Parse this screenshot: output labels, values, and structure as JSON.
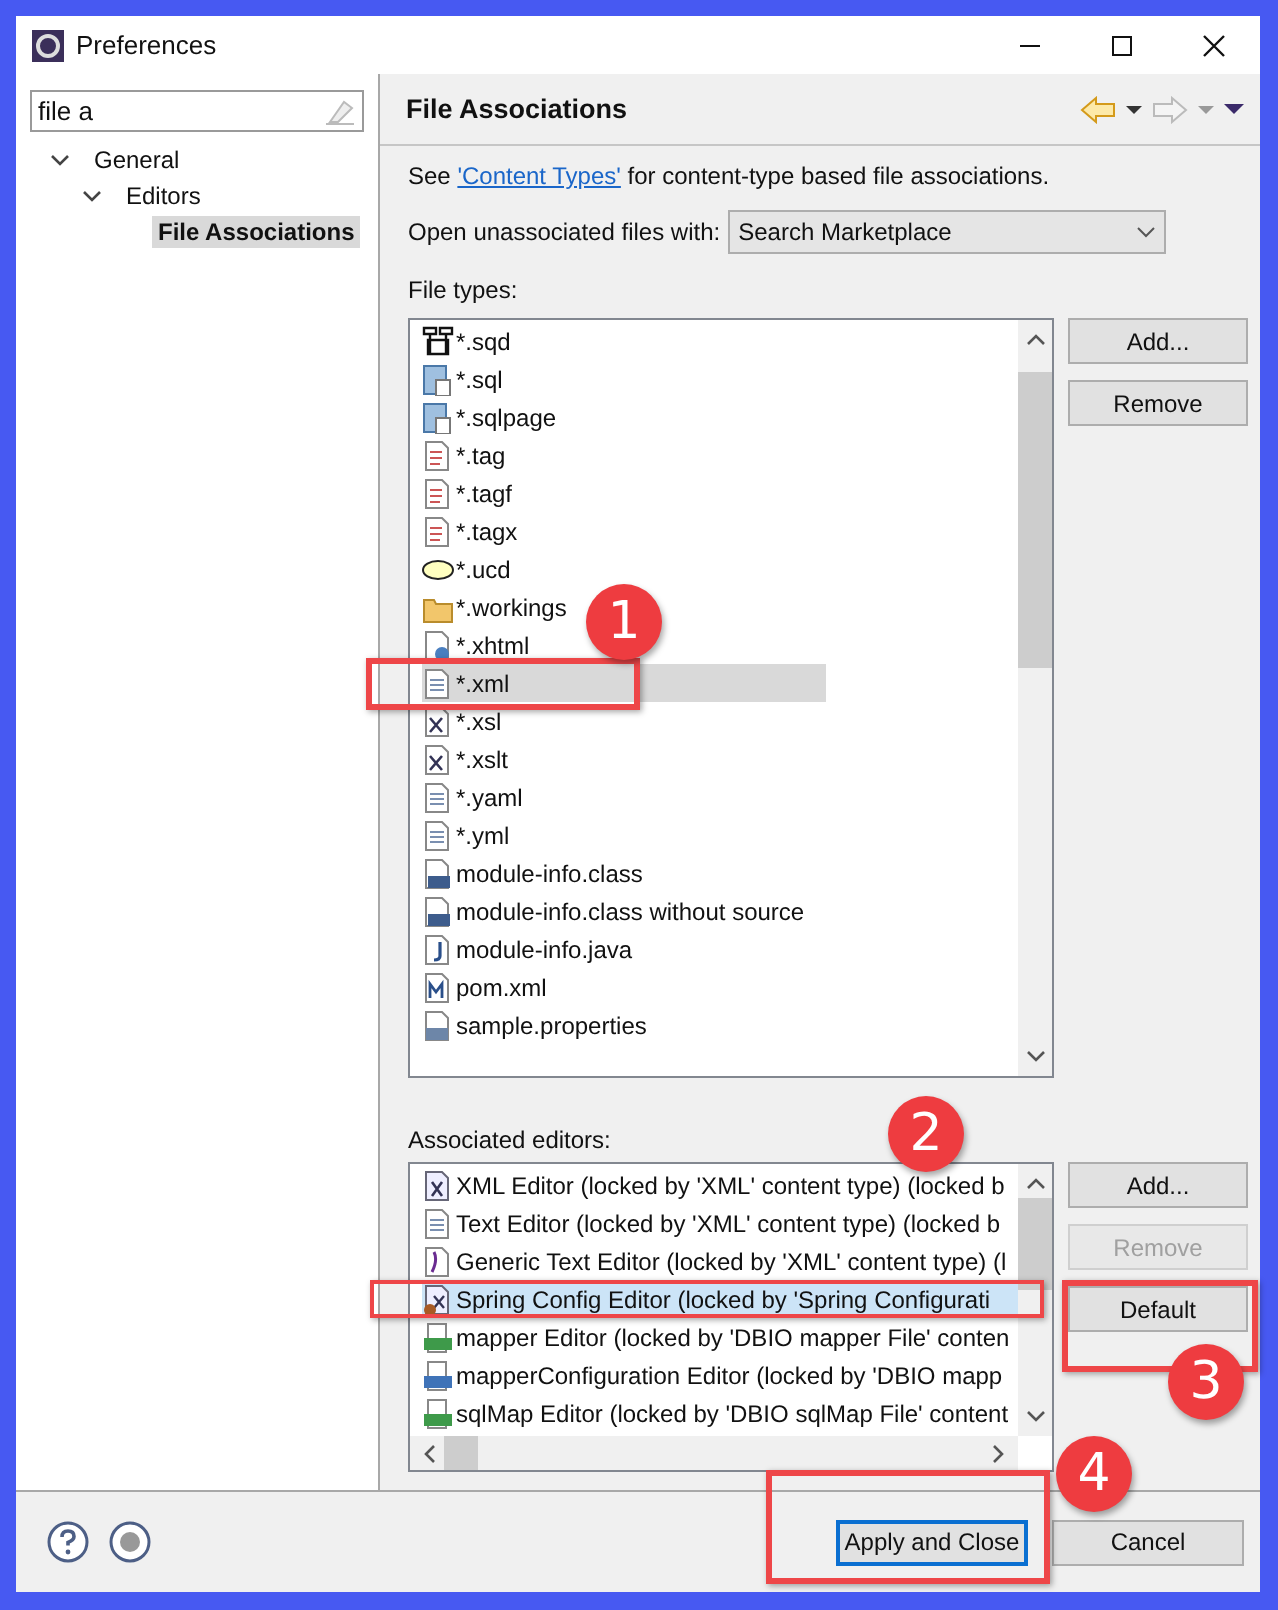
{
  "window": {
    "title": "Preferences"
  },
  "filter": {
    "value": "file a"
  },
  "tree": [
    {
      "label": "General",
      "expanded": true,
      "selected": false,
      "children": [
        {
          "label": "Editors",
          "expanded": true,
          "selected": false,
          "children": [
            {
              "label": "File Associations",
              "selected": true
            }
          ]
        }
      ]
    }
  ],
  "page": {
    "title": "File Associations",
    "description": {
      "before": "See ",
      "link": "'Content Types'",
      "after": " for content-type based file associations."
    },
    "open_with": {
      "label": "Open unassociated files with:",
      "value": "Search Marketplace"
    },
    "file_types": {
      "label": "File types:",
      "items": [
        {
          "label": "*.sqd",
          "kind": "diagram",
          "selected": false
        },
        {
          "label": "*.sql",
          "kind": "sql",
          "selected": false
        },
        {
          "label": "*.sqlpage",
          "kind": "sql",
          "selected": false
        },
        {
          "label": "*.tag",
          "kind": "tag",
          "selected": false
        },
        {
          "label": "*.tagf",
          "kind": "tag",
          "selected": false
        },
        {
          "label": "*.tagx",
          "kind": "tag",
          "selected": false
        },
        {
          "label": "*.ucd",
          "kind": "ellipse",
          "selected": false
        },
        {
          "label": "*.workings",
          "kind": "folder",
          "selected": false
        },
        {
          "label": "*.xhtml",
          "kind": "web",
          "selected": false
        },
        {
          "label": "*.xml",
          "kind": "text",
          "selected": true
        },
        {
          "label": "*.xsl",
          "kind": "xsl",
          "selected": false
        },
        {
          "label": "*.xslt",
          "kind": "xsl",
          "selected": false
        },
        {
          "label": "*.yaml",
          "kind": "text",
          "selected": false
        },
        {
          "label": "*.yml",
          "kind": "text",
          "selected": false
        },
        {
          "label": "module-info.class",
          "kind": "binary",
          "selected": false
        },
        {
          "label": "module-info.class without source",
          "kind": "binary",
          "selected": false
        },
        {
          "label": "module-info.java",
          "kind": "java",
          "selected": false
        },
        {
          "label": "pom.xml",
          "kind": "maven",
          "selected": false
        },
        {
          "label": "sample.properties",
          "kind": "props",
          "selected": false
        }
      ],
      "buttons": [
        {
          "label": "Add...",
          "disabled": false
        },
        {
          "label": "Remove",
          "disabled": false
        }
      ]
    },
    "editors": {
      "label": "Associated editors:",
      "items": [
        {
          "label": "XML Editor (locked by 'XML' content type) (locked b",
          "kind": "xml",
          "selected": false
        },
        {
          "label": "Text Editor (locked by 'XML' content type) (locked b",
          "kind": "text",
          "selected": false
        },
        {
          "label": "Generic Text Editor (locked by 'XML' content type) (l",
          "kind": "generic",
          "selected": false
        },
        {
          "label": "Spring Config Editor (locked by 'Spring Configurati",
          "kind": "spring",
          "selected": true
        },
        {
          "label": "mapper Editor (locked by 'DBIO mapper File' conten",
          "kind": "mapper",
          "selected": false
        },
        {
          "label": "mapperConfiguration Editor (locked by 'DBIO mapp",
          "kind": "config",
          "selected": false
        },
        {
          "label": "sqlMap Editor (locked by 'DBIO sqlMap File' content",
          "kind": "mapper",
          "selected": false
        }
      ],
      "buttons": [
        {
          "label": "Add...",
          "disabled": false
        },
        {
          "label": "Remove",
          "disabled": true
        },
        {
          "label": "Default",
          "disabled": false
        }
      ]
    }
  },
  "footer": {
    "buttons": [
      {
        "label": "Apply and Close",
        "default": true
      },
      {
        "label": "Cancel",
        "default": false
      }
    ]
  },
  "annotations": [
    {
      "label": "1"
    },
    {
      "label": "2"
    },
    {
      "label": "3"
    },
    {
      "label": "4"
    }
  ]
}
